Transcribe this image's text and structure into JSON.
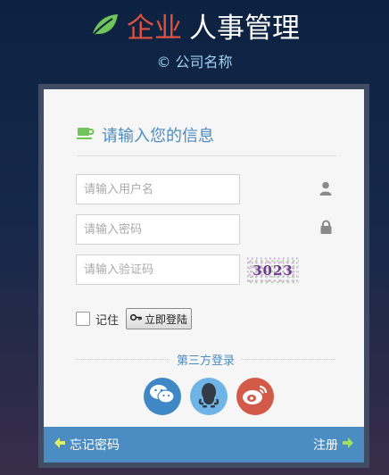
{
  "brand": {
    "title_accent": "企业",
    "title_rest": "人事管理",
    "subtitle": "© 公司名称"
  },
  "form": {
    "heading": "请输入您的信息",
    "username": {
      "placeholder": "请输入用户名",
      "value": ""
    },
    "password": {
      "placeholder": "请输入密码",
      "value": ""
    },
    "captcha_input": {
      "placeholder": "请输入验证码",
      "value": ""
    },
    "captcha_text": "3023",
    "remember_label": "记住",
    "login_label": "立即登陆"
  },
  "third_party": {
    "label": "第三方登录",
    "providers": [
      {
        "name": "wechat",
        "color": "#3f88c5"
      },
      {
        "name": "qq",
        "color": "#6fb4e6"
      },
      {
        "name": "weibo",
        "color": "#d35a48"
      }
    ]
  },
  "footer": {
    "forgot_label": "忘记密码",
    "register_label": "注册"
  },
  "colors": {
    "accent_green": "#6fc55a",
    "footer_blue": "#4b8cc3",
    "heading_blue": "#4c8cc1",
    "brand_red": "#e0523f"
  }
}
